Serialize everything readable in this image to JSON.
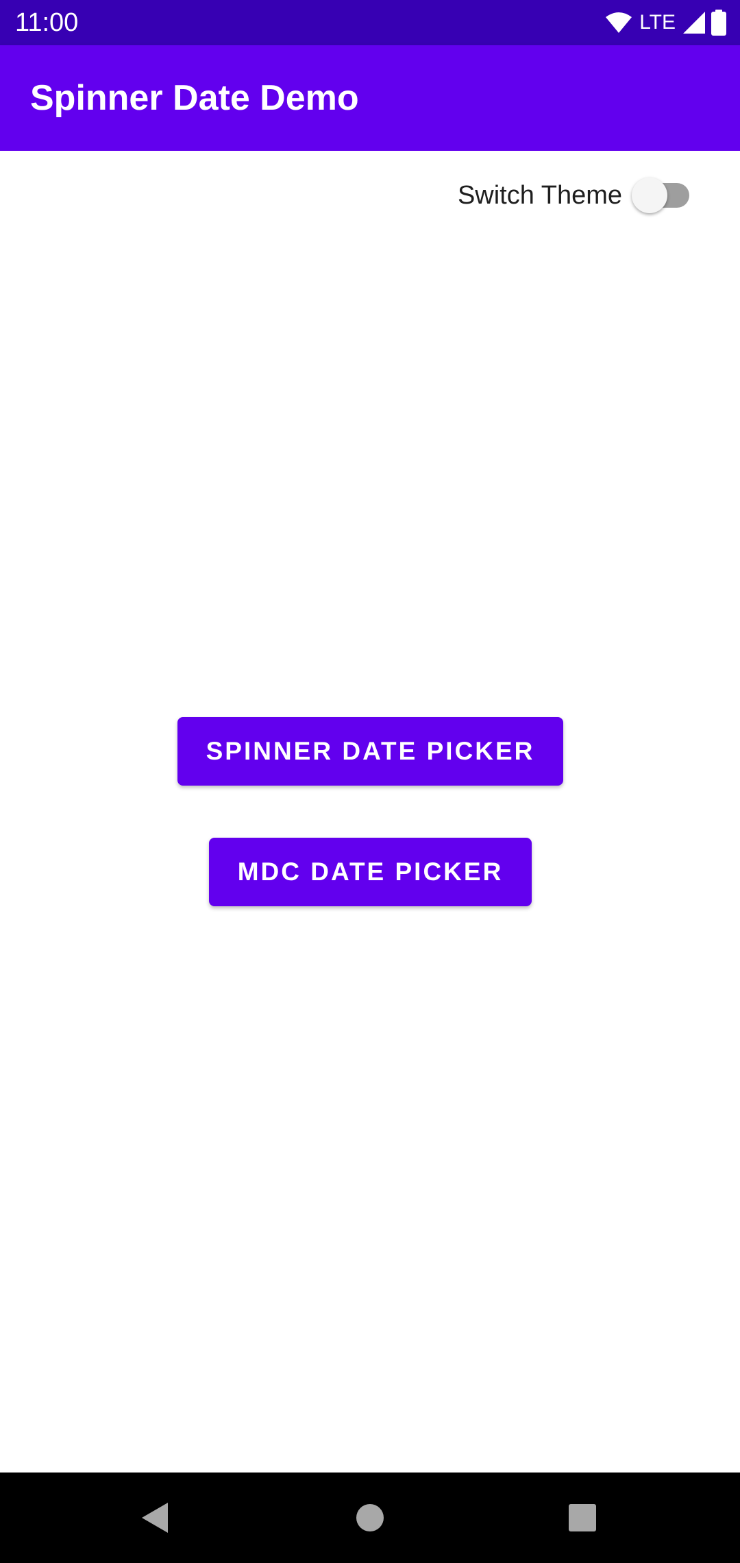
{
  "status_bar": {
    "time": "11:00",
    "network_label": "LTE",
    "icons": [
      "wifi-icon",
      "cell-signal-icon",
      "battery-icon"
    ]
  },
  "app_bar": {
    "title": "Spinner Date Demo"
  },
  "theme_switch": {
    "label": "Switch Theme",
    "checked": false
  },
  "buttons": {
    "spinner_date_picker": "SPINNER DATE PICKER",
    "mdc_date_picker": "MDC DATE PICKER"
  },
  "nav_bar": {
    "icons": [
      "back-icon",
      "home-icon",
      "recents-icon"
    ]
  },
  "colors": {
    "status_bar": "#3700B3",
    "primary": "#6200EE",
    "on_primary": "#FFFFFF",
    "background": "#FFFFFF",
    "nav_bar": "#000000"
  }
}
